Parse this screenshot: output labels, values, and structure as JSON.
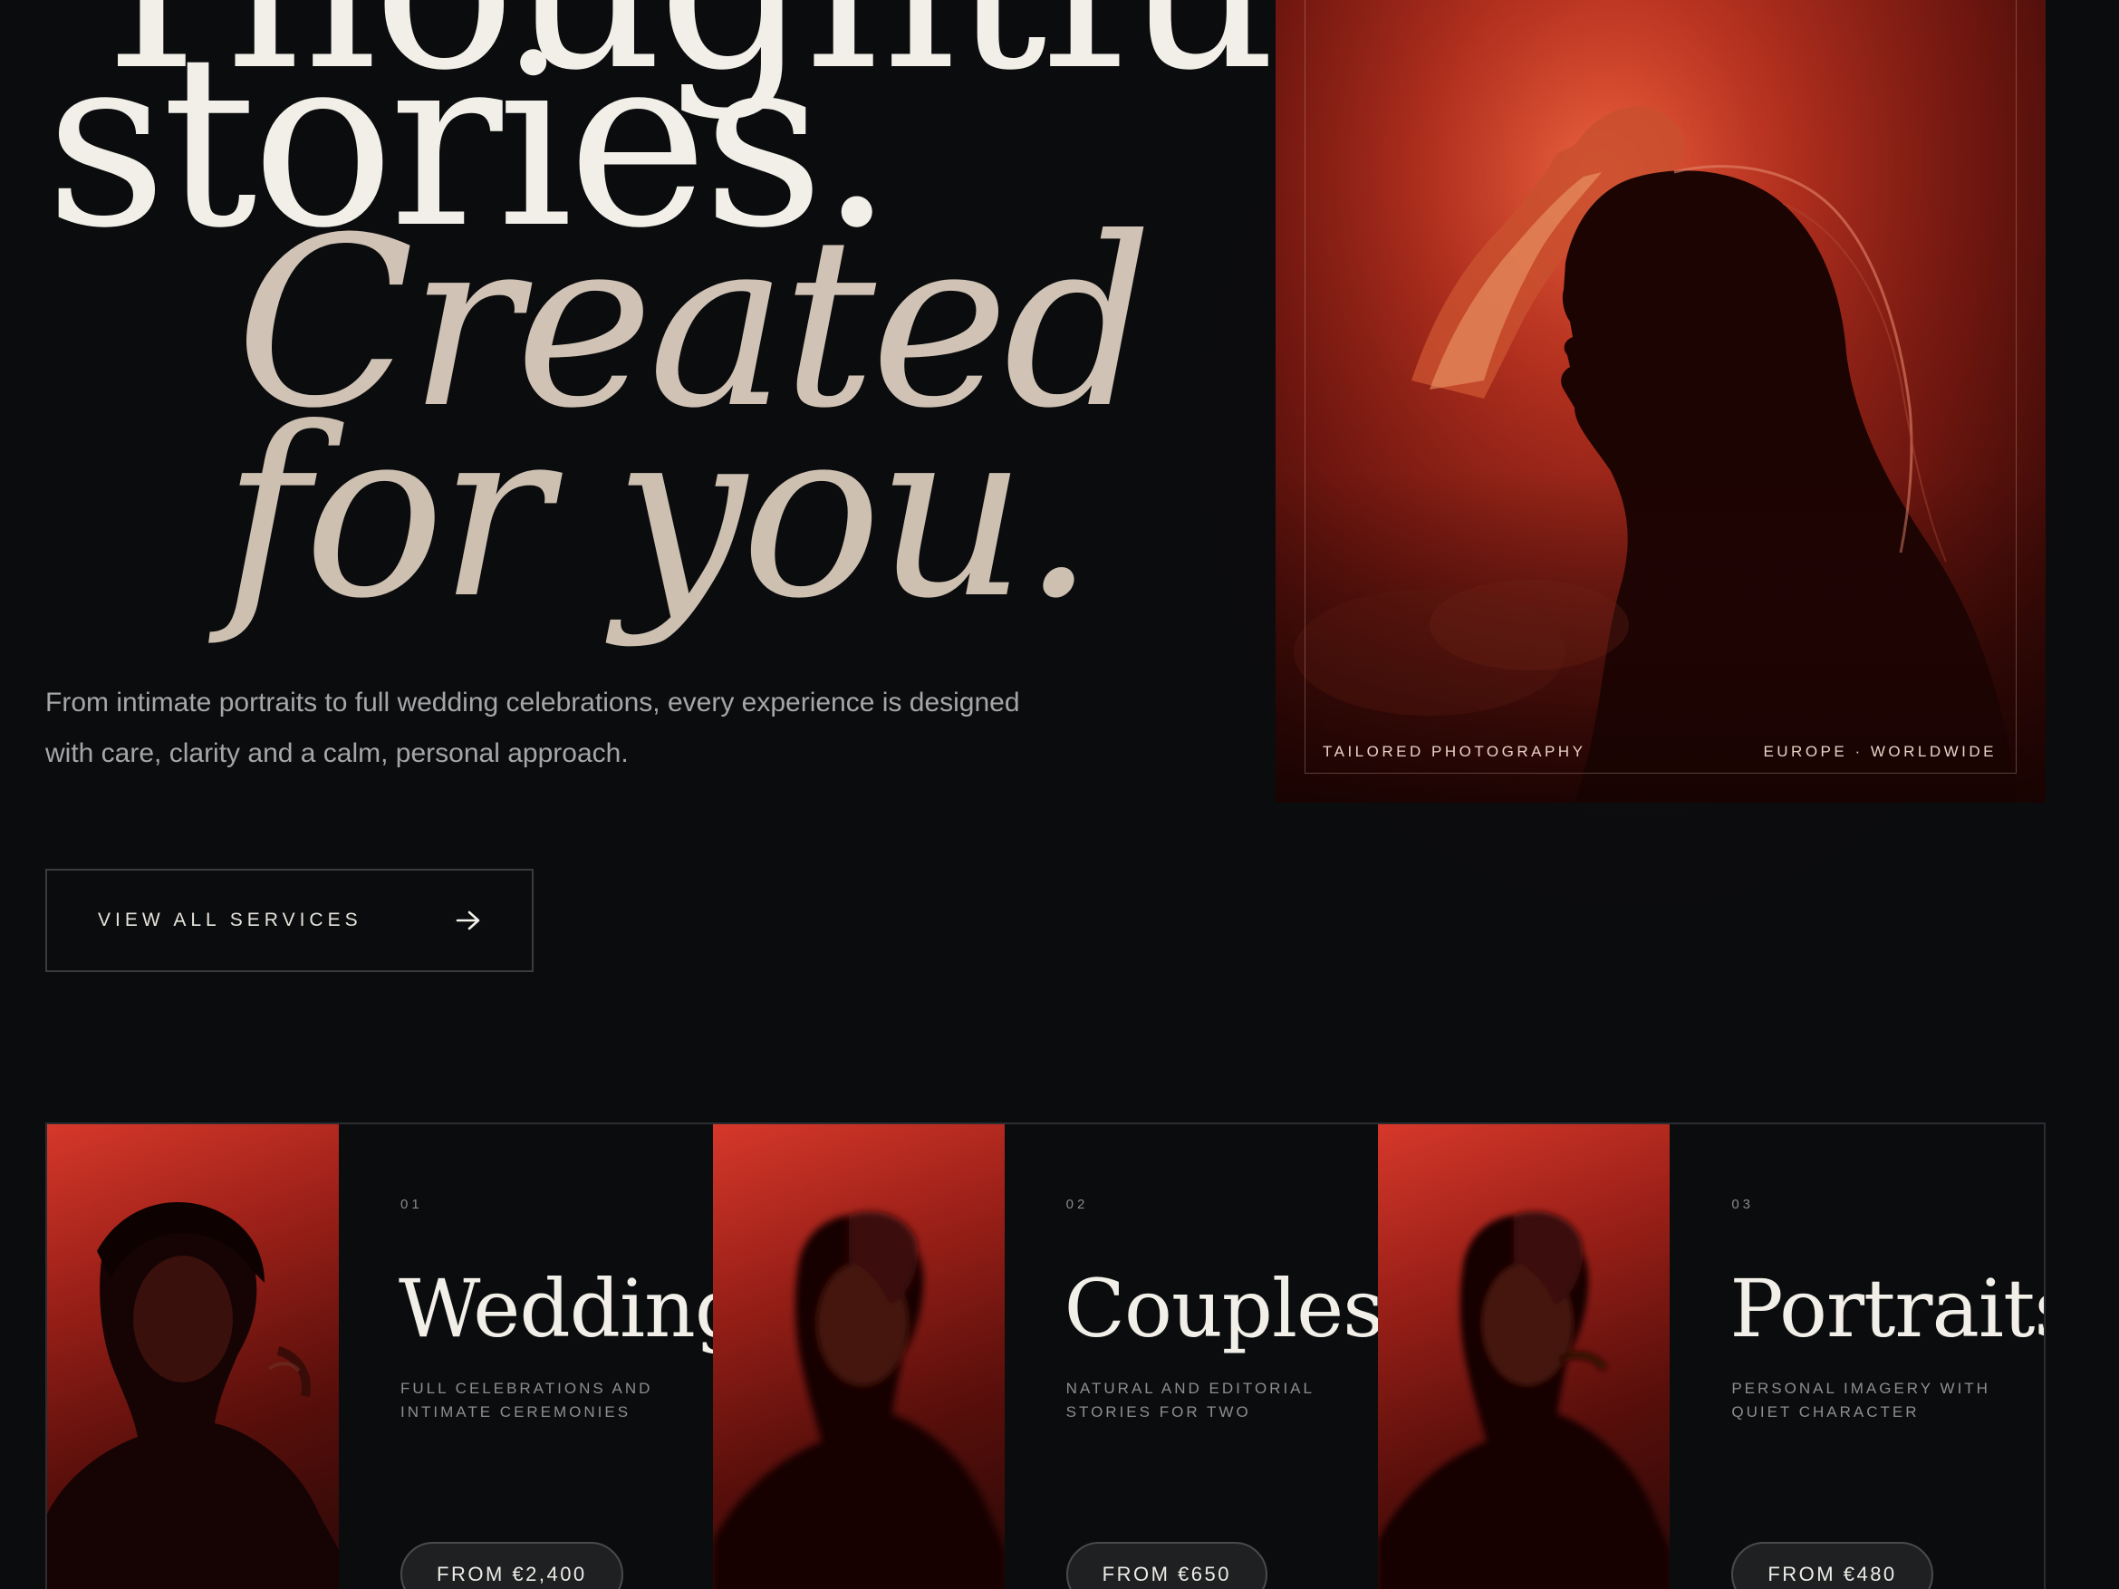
{
  "hero": {
    "headline_line1": "Thoughtful",
    "headline_line2": "stories.",
    "headline_line3": "Created",
    "headline_line4": "for you.",
    "lede": "From intimate portraits to full wedding celebrations, every experience is designed with care, clarity and a calm, personal approach.",
    "cta_label": "VIEW ALL SERVICES",
    "cta_icon": "arrow-right-icon",
    "image_caption_left": "TAILORED PHOTOGRAPHY",
    "image_caption_right": "EUROPE · WORLDWIDE"
  },
  "services": [
    {
      "number": "01",
      "title": "Weddings",
      "description": "FULL CELEBRATIONS AND INTIMATE CEREMONIES",
      "price": "FROM €2,400"
    },
    {
      "number": "02",
      "title": "Couples",
      "description": "NATURAL AND EDITORIAL STORIES FOR TWO",
      "price": "FROM €650"
    },
    {
      "number": "03",
      "title": "Portraits",
      "description": "PERSONAL IMAGERY WITH QUIET CHARACTER",
      "price": "FROM €480"
    }
  ],
  "colors": {
    "background": "#0b0c0e",
    "headline": "#f1efe8",
    "headline_italic": "#d0c3b5",
    "accent_red": "#b52a1c",
    "muted_text": "#a6a6a8",
    "border": "#2c2d31"
  }
}
